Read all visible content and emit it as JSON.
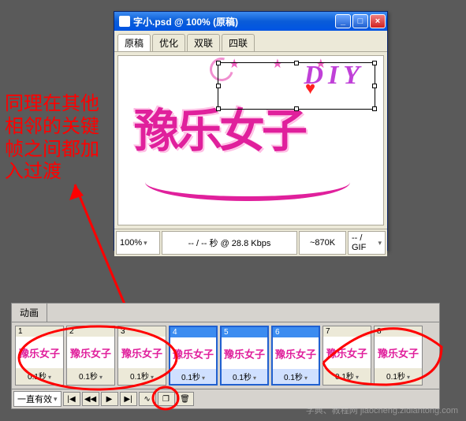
{
  "doc": {
    "title": "字小.psd @ 100% (原稿)",
    "tabs": [
      "原稿",
      "优化",
      "双联",
      "四联"
    ],
    "zoom": "100%",
    "ratestats": "-- / -- 秒 @ 28.8 Kbps",
    "filesize": "~870K",
    "format": "-- / GIF"
  },
  "artwork": {
    "main_text": "豫乐女子",
    "diy_text": "DIY"
  },
  "annotation": {
    "line1": "同理在其他",
    "line2": "相邻的关键",
    "line3": "帧之间都加",
    "line4": "入过渡"
  },
  "anim": {
    "panel_title": "动画",
    "loop": "一直有效",
    "frames": [
      {
        "num": "1",
        "delay": "0.1秒",
        "selected": false
      },
      {
        "num": "2",
        "delay": "0.1秒",
        "selected": false
      },
      {
        "num": "3",
        "delay": "0.1秒",
        "selected": false
      },
      {
        "num": "4",
        "delay": "0.1秒",
        "selected": true
      },
      {
        "num": "5",
        "delay": "0.1秒",
        "selected": true
      },
      {
        "num": "6",
        "delay": "0.1秒",
        "selected": true
      },
      {
        "num": "7",
        "delay": "0.1秒",
        "selected": false
      },
      {
        "num": "8",
        "delay": "0.1秒",
        "selected": false
      }
    ]
  },
  "watermark": "字典、教程网 jiaocheng.zidiantong.com"
}
